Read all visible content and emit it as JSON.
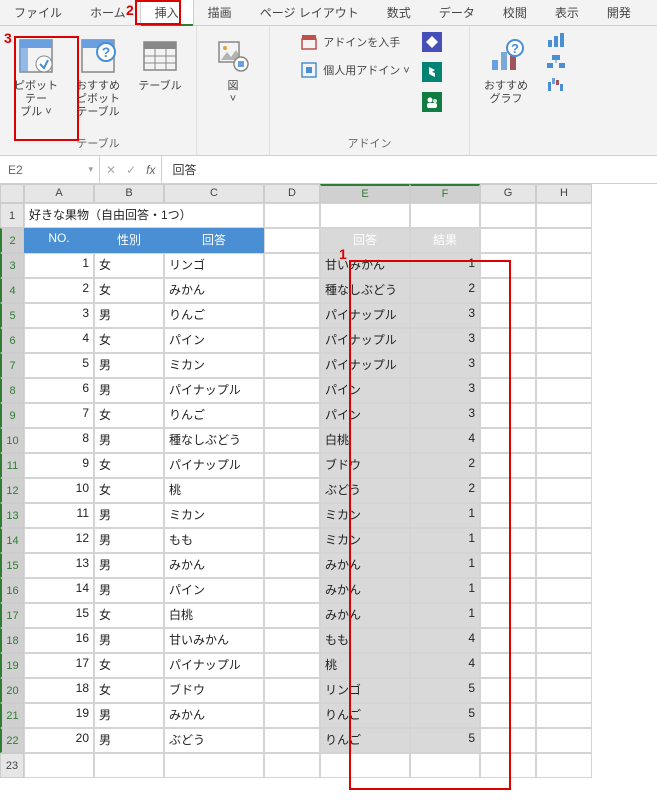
{
  "tabs": {
    "file": "ファイル",
    "home": "ホーム",
    "insert": "挿入",
    "draw": "描画",
    "pagelayout": "ページ レイアウト",
    "formulas": "数式",
    "data": "データ",
    "review": "校閲",
    "view": "表示",
    "developer": "開発"
  },
  "ribbon": {
    "tables": {
      "pivot": "ピボットテー\nブル ˅",
      "recommend_pivot": "おすすめ\nピボットテーブル",
      "table": "テーブル",
      "group": "テーブル"
    },
    "illustrations": {
      "zu": "図\n˅"
    },
    "addins": {
      "get": "アドインを入手",
      "personal": "個人用アドイン  ˅",
      "group": "アドイン"
    },
    "recommended_charts": "おすすめ\nグラフ"
  },
  "formula": {
    "name": "E2",
    "value": "回答",
    "fx": "fx",
    "x": "✕",
    "check": "✓"
  },
  "cols": [
    "",
    "A",
    "B",
    "C",
    "D",
    "E",
    "F",
    "G",
    "H"
  ],
  "title": "好きな果物（自由回答・1つ）",
  "left_headers": {
    "no": "NO.",
    "sex": "性別",
    "answer": "回答"
  },
  "right_headers": {
    "answer": "回答",
    "result": "結果"
  },
  "left_rows": [
    {
      "no": 1,
      "sex": "女",
      "a": "リンゴ"
    },
    {
      "no": 2,
      "sex": "女",
      "a": "みかん"
    },
    {
      "no": 3,
      "sex": "男",
      "a": "りんご"
    },
    {
      "no": 4,
      "sex": "女",
      "a": "パイン"
    },
    {
      "no": 5,
      "sex": "男",
      "a": "ミカン"
    },
    {
      "no": 6,
      "sex": "男",
      "a": "パイナップル"
    },
    {
      "no": 7,
      "sex": "女",
      "a": "りんご"
    },
    {
      "no": 8,
      "sex": "男",
      "a": "種なしぶどう"
    },
    {
      "no": 9,
      "sex": "女",
      "a": "パイナップル"
    },
    {
      "no": 10,
      "sex": "女",
      "a": "桃"
    },
    {
      "no": 11,
      "sex": "男",
      "a": "ミカン"
    },
    {
      "no": 12,
      "sex": "男",
      "a": "もも"
    },
    {
      "no": 13,
      "sex": "男",
      "a": "みかん"
    },
    {
      "no": 14,
      "sex": "男",
      "a": "パイン"
    },
    {
      "no": 15,
      "sex": "女",
      "a": "白桃"
    },
    {
      "no": 16,
      "sex": "男",
      "a": "甘いみかん"
    },
    {
      "no": 17,
      "sex": "女",
      "a": "パイナップル"
    },
    {
      "no": 18,
      "sex": "女",
      "a": "ブドウ"
    },
    {
      "no": 19,
      "sex": "男",
      "a": "みかん"
    },
    {
      "no": 20,
      "sex": "男",
      "a": "ぶどう"
    }
  ],
  "right_rows": [
    {
      "a": "甘いみかん",
      "r": 1
    },
    {
      "a": "種なしぶどう",
      "r": 2
    },
    {
      "a": "パイナップル",
      "r": 3
    },
    {
      "a": "パイナップル",
      "r": 3
    },
    {
      "a": "パイナップル",
      "r": 3
    },
    {
      "a": "パイン",
      "r": 3
    },
    {
      "a": "パイン",
      "r": 3
    },
    {
      "a": "白桃",
      "r": 4
    },
    {
      "a": "ブドウ",
      "r": 2
    },
    {
      "a": "ぶどう",
      "r": 2
    },
    {
      "a": "ミカン",
      "r": 1
    },
    {
      "a": "ミカン",
      "r": 1
    },
    {
      "a": "みかん",
      "r": 1
    },
    {
      "a": "みかん",
      "r": 1
    },
    {
      "a": "みかん",
      "r": 1
    },
    {
      "a": "もも",
      "r": 4
    },
    {
      "a": "桃",
      "r": 4
    },
    {
      "a": "リンゴ",
      "r": 5
    },
    {
      "a": "りんご",
      "r": 5
    },
    {
      "a": "りんご",
      "r": 5
    }
  ],
  "markers": {
    "m1": "1",
    "m2": "2",
    "m3": "3"
  }
}
